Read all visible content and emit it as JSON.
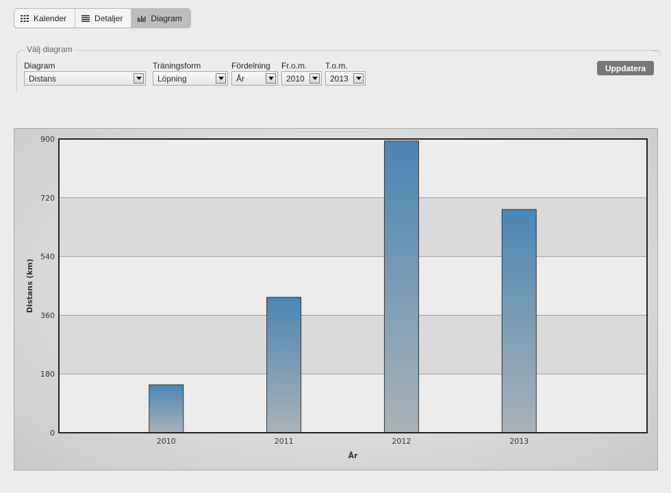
{
  "tabs": [
    {
      "label": "Kalender",
      "icon": "grid-icon",
      "active": false
    },
    {
      "label": "Detaljer",
      "icon": "list-icon",
      "active": false
    },
    {
      "label": "Diagram",
      "icon": "bar-chart-icon",
      "active": true
    }
  ],
  "filter": {
    "legend": "Välj diagram",
    "fields": [
      {
        "label": "Diagram",
        "value": "Distans"
      },
      {
        "label": "Träningsform",
        "value": "Löpning"
      },
      {
        "label": "Fördelning",
        "value": "År"
      },
      {
        "label": "Fr.o.m.",
        "value": "2010"
      },
      {
        "label": "T.o.m.",
        "value": "2013"
      }
    ],
    "update_label": "Uppdatera"
  },
  "colors": {
    "bar_top": "#4a86b4",
    "bar_bottom": "#aab2b8",
    "accent": "#777777"
  },
  "chart_data": {
    "type": "bar",
    "categories": [
      "2010",
      "2011",
      "2012",
      "2013"
    ],
    "values": [
      147,
      415,
      894,
      684
    ],
    "xlabel": "År",
    "ylabel": "Distans (km)",
    "ylim": [
      0,
      900
    ],
    "yticks": [
      "0",
      "180",
      "360",
      "540",
      "720",
      "900"
    ],
    "grid": true
  }
}
